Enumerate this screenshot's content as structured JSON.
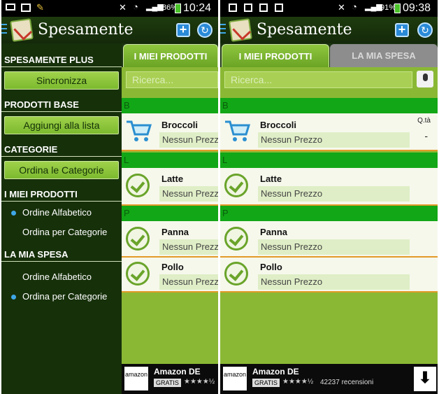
{
  "left": {
    "status": {
      "battery": "86%",
      "time": "10:24"
    },
    "app_title": "Spesamente",
    "drawer": {
      "sec1": "SPESAMENTE PLUS",
      "btn_sync": "Sincronizza",
      "sec2": "PRODOTTI BASE",
      "btn_add": "Aggiungi alla lista",
      "sec3": "CATEGORIE",
      "btn_order": "Ordina le Categorie",
      "sec4": "I MIEI PRODOTTI",
      "opt4a": "Ordine Alfabetico",
      "opt4b": "Ordina per Categorie",
      "sec5": "LA MIA SPESA",
      "opt5a": "Ordine Alfabetico",
      "opt5b": "Ordina per Categorie"
    },
    "tab_active": "I MIEI PRODOTTI",
    "search_placeholder": "Ricerca...",
    "sections": [
      "B",
      "L",
      "P"
    ],
    "items": [
      {
        "name": "Broccoli",
        "price": "Nessun Prezzo"
      },
      {
        "name": "Latte",
        "price": "Nessun Prezzo"
      },
      {
        "name": "Panna",
        "price": "Nessun Prezzo"
      },
      {
        "name": "Pollo",
        "price": "Nessun Prezzo"
      }
    ],
    "ad": {
      "name": "Amazon DE",
      "tag": "GRATIS",
      "stars": "★★★★½",
      "logo": "amazon"
    }
  },
  "right": {
    "status": {
      "battery": "91%",
      "time": "09:38"
    },
    "app_title": "Spesamente",
    "tab_active": "I MIEI PRODOTTI",
    "tab_inactive": "LA MIA SPESA",
    "search_placeholder": "Ricerca...",
    "sections": [
      "B",
      "L",
      "P"
    ],
    "qty_label": "Q.tà",
    "qty_value": "-",
    "items": [
      {
        "name": "Broccoli",
        "price": "Nessun Prezzo"
      },
      {
        "name": "Latte",
        "price": "Nessun Prezzo"
      },
      {
        "name": "Panna",
        "price": "Nessun Prezzo"
      },
      {
        "name": "Pollo",
        "price": "Nessun Prezzo"
      }
    ],
    "ad": {
      "name": "Amazon DE",
      "tag": "GRATIS",
      "stars": "★★★★½",
      "reviews": "42237 recensioni",
      "logo": "amazon",
      "download_icon": "⬇"
    }
  }
}
